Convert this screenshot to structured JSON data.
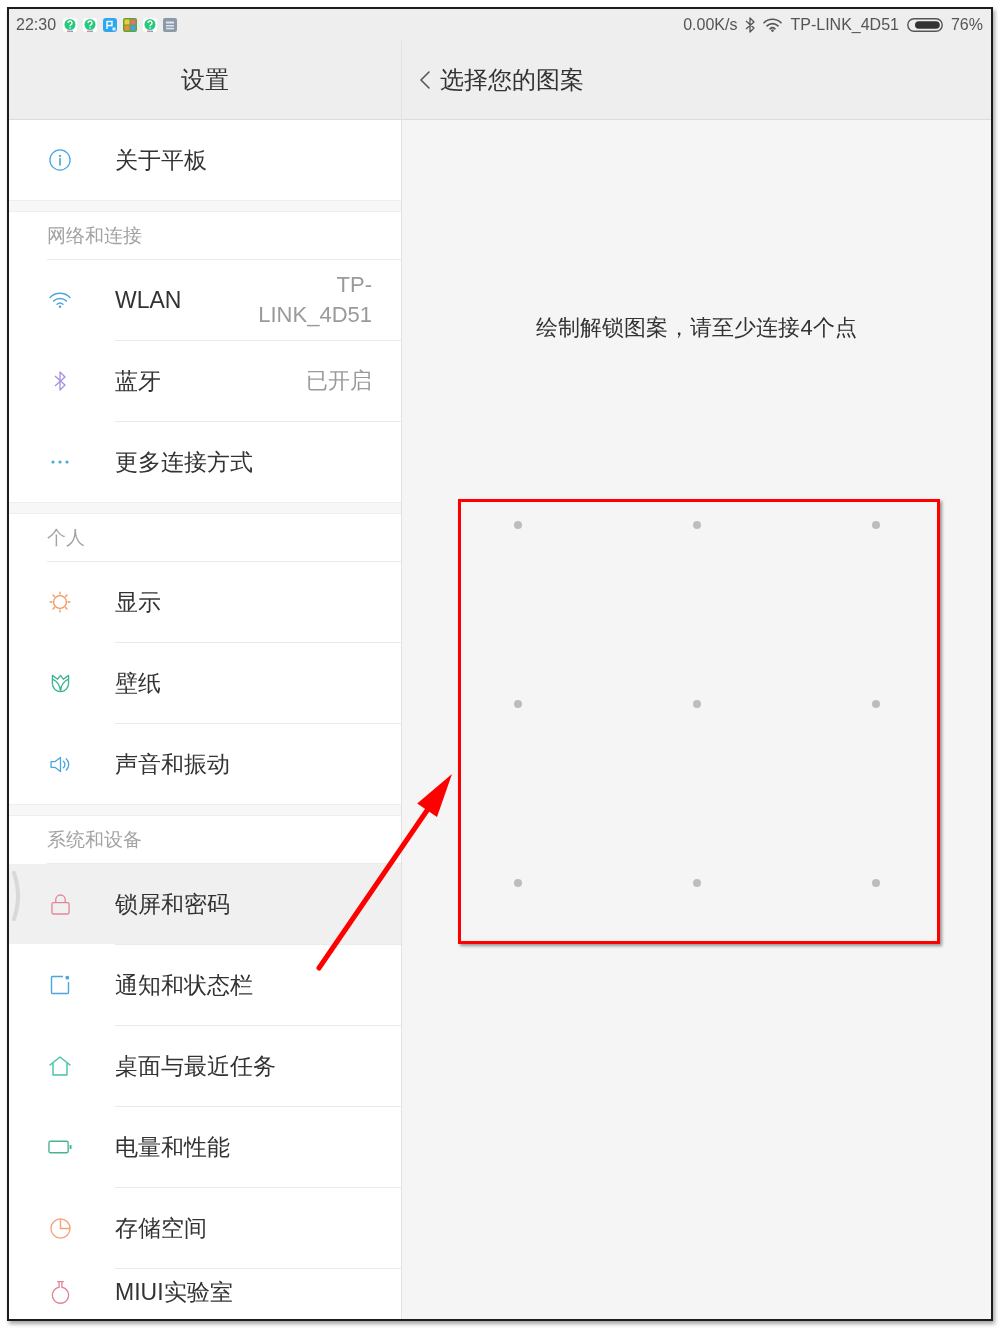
{
  "status_bar": {
    "time": "22:30",
    "network_speed": "0.00K/s",
    "wifi_name": "TP-LINK_4D51",
    "battery": "76%"
  },
  "sidebar": {
    "title": "设置",
    "groups": [
      {
        "items": [
          {
            "label": "关于平板",
            "selected": false
          }
        ]
      },
      {
        "header": "网络和连接",
        "items": [
          {
            "label": "WLAN",
            "value": "TP-LINK_4D51",
            "selected": false
          },
          {
            "label": "蓝牙",
            "value": "已开启",
            "selected": false
          },
          {
            "label": "更多连接方式",
            "selected": false
          }
        ]
      },
      {
        "header": "个人",
        "items": [
          {
            "label": "显示",
            "selected": false
          },
          {
            "label": "壁纸",
            "selected": false
          },
          {
            "label": "声音和振动",
            "selected": false
          }
        ]
      },
      {
        "header": "系统和设备",
        "items": [
          {
            "label": "锁屏和密码",
            "selected": true
          },
          {
            "label": "通知和状态栏",
            "selected": false
          },
          {
            "label": "桌面与最近任务",
            "selected": false
          },
          {
            "label": "电量和性能",
            "selected": false
          },
          {
            "label": "存储空间",
            "selected": false
          },
          {
            "label": "MIUI实验室",
            "selected": false
          }
        ]
      }
    ]
  },
  "pattern_page": {
    "title": "选择您的图案",
    "instruction": "绘制解锁图案，请至少连接4个点"
  }
}
